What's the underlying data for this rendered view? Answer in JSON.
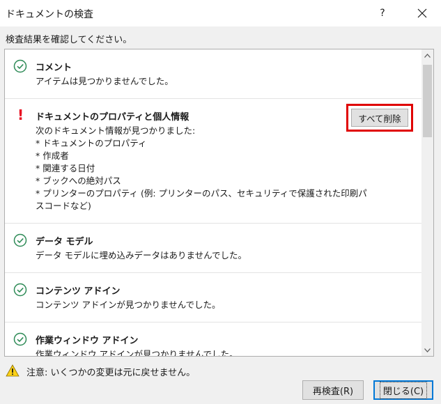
{
  "window": {
    "title": "ドキュメントの検査",
    "help_label": "?"
  },
  "instruction": "検査結果を確認してください。",
  "sections": [
    {
      "status": "ok",
      "title": "コメント",
      "description": [
        "アイテムは見つかりませんでした。"
      ]
    },
    {
      "status": "warning",
      "title": "ドキュメントのプロパティと個人情報",
      "description": [
        "次のドキュメント情報が見つかりました:",
        "* ドキュメントのプロパティ",
        "* 作成者",
        "* 関連する日付",
        "* ブックへの絶対パス",
        "* プリンターのプロパティ (例: プリンターのパス、セキュリティで保護された印刷パ",
        "スコードなど)"
      ],
      "button_label": "すべて削除"
    },
    {
      "status": "ok",
      "title": "データ モデル",
      "description": [
        "データ モデルに埋め込みデータはありませんでした。"
      ]
    },
    {
      "status": "ok",
      "title": "コンテンツ アドイン",
      "description": [
        "コンテンツ アドインが見つかりませんでした。"
      ]
    },
    {
      "status": "ok",
      "title": "作業ウィンドウ アドイン",
      "description": [
        "作業ウィンドウ アドインが見つかりませんでした。"
      ]
    }
  ],
  "notice": {
    "icon": "warning-triangle-icon",
    "text": "注意: いくつかの変更は元に戻せません。"
  },
  "buttons": {
    "recheck": "再検査(R)",
    "close": "閉じる(C)"
  },
  "colors": {
    "ok_icon": "#2e8b57",
    "warning_mark": "#e81123",
    "highlight": "#e00000",
    "focus_border": "#0078d7"
  }
}
